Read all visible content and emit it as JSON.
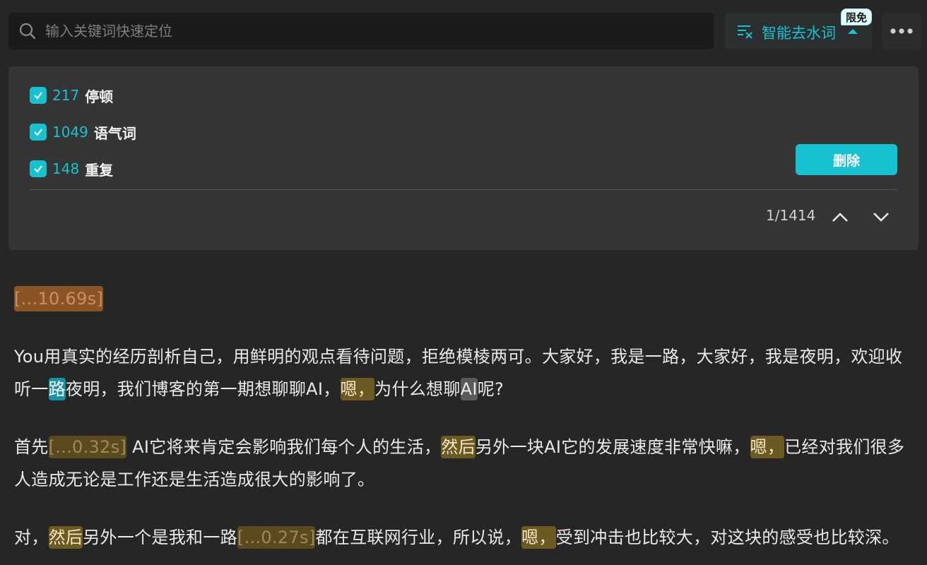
{
  "search": {
    "placeholder": "输入关键词快速定位"
  },
  "smart": {
    "label": "智能去水词",
    "badge": "限免"
  },
  "filters": [
    {
      "count": "217",
      "name": "停顿"
    },
    {
      "count": "1049",
      "name": "语气词"
    },
    {
      "count": "148",
      "name": "重复"
    }
  ],
  "actions": {
    "delete": "删除"
  },
  "pager": {
    "position": "1/1414"
  },
  "transcript": {
    "p0": {
      "pause": "[...10.69s]"
    },
    "p1": {
      "t1": "You用真实的经历剖析自己，用鲜明的观点看待问题，拒绝模棱两可。大家好，我是一路，大家好，我是夜明，欢迎收听一",
      "cur": "路",
      "t2": "夜明，我们博客的第一期想聊聊AI，",
      "f1": "嗯，",
      "t3": "为什么想聊",
      "rep": "AI",
      "t4": "呢?"
    },
    "p2": {
      "t1": "首先",
      "pause": "[...0.32s]",
      "t2": " AI它将来肯定会影响我们每个人的生活，",
      "f1": "然后",
      "t3": "另外一块AI它的发展速度非常快嘛，",
      "f2": "嗯，",
      "t4": "已经对我们很多人造成无论是工作还是生活造成很大的影响了。"
    },
    "p3": {
      "t1": "对，",
      "f1": "然后",
      "t2": "另外一个是我和一路",
      "pause": "[...0.27s]",
      "t3": "都在互联网行业，所以说，",
      "f2": "嗯，",
      "t4": "受到冲击也比较大，对这块的感受也比较深。"
    }
  }
}
